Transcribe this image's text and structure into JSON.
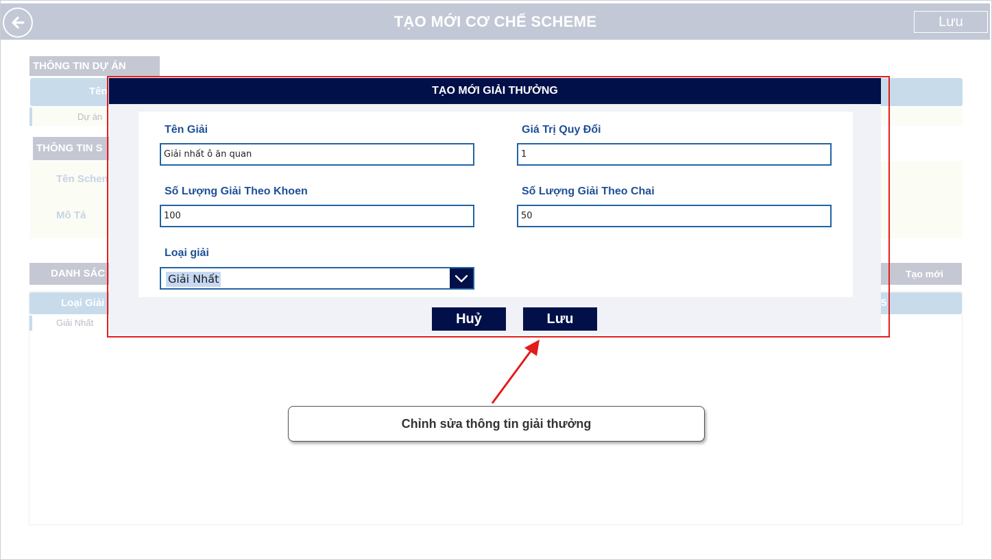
{
  "header": {
    "title": "TẠO MỚI CƠ CHẾ SCHEME",
    "save_label": "Lưu"
  },
  "background": {
    "project_section_title": "THÔNG TIN DỰ ÁN",
    "project_table_header": "Tên",
    "project_row_value": "Dự án",
    "scheme_section_title": "THÔNG TIN S",
    "scheme_name_label": "Tên Schen",
    "scheme_desc_label": "Mô Tả",
    "list_section_title": "DANH SÁC",
    "create_new_label": "Tạo mới",
    "list_column_header": "Loại Giải",
    "list_column_tail": "5",
    "list_row_value": "Giải Nhất"
  },
  "modal": {
    "title": "TẠO MỚI GIẢI THƯỞNG",
    "fields": {
      "prize_name_label": "Tên Giải",
      "prize_name_value": "Giải nhất ô ăn quan",
      "exchange_value_label": "Giá Trị Quy Đổi",
      "exchange_value_value": "1",
      "qty_khoen_label": "Số Lượng Giải Theo Khoen",
      "qty_khoen_value": "100",
      "qty_chai_label": "Số Lượng Giải Theo Chai",
      "qty_chai_value": "50",
      "prize_type_label": "Loại giải",
      "prize_type_value": "Giải Nhất"
    },
    "cancel_label": "Huỷ",
    "save_label": "Lưu"
  },
  "callout": {
    "text": "Chỉnh sửa thông tin giải thưởng"
  },
  "colors": {
    "header_bg": "#c3c8d6",
    "modal_header": "#011049",
    "label_blue": "#1e4f96",
    "input_border": "#2163a2",
    "highlight_red": "#e21b1b"
  },
  "icons": {
    "back": "arrow-left-circle-icon",
    "dropdown": "chevron-down-icon"
  }
}
